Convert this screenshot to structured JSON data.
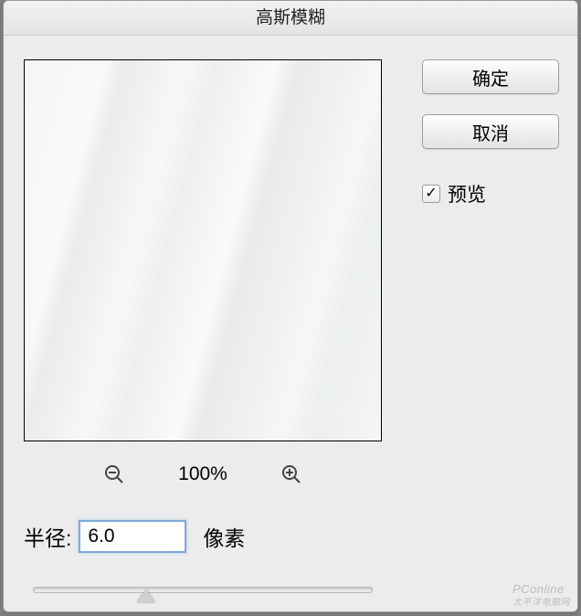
{
  "dialog": {
    "title": "高斯模糊"
  },
  "buttons": {
    "ok": "确定",
    "cancel": "取消"
  },
  "preview_checkbox": {
    "label": "预览",
    "checked": true
  },
  "zoom": {
    "level": "100%"
  },
  "radius": {
    "label": "半径:",
    "value": "6.0",
    "unit": "像素"
  },
  "watermark": {
    "main": "PConline",
    "sub": "太平洋电脑网"
  }
}
